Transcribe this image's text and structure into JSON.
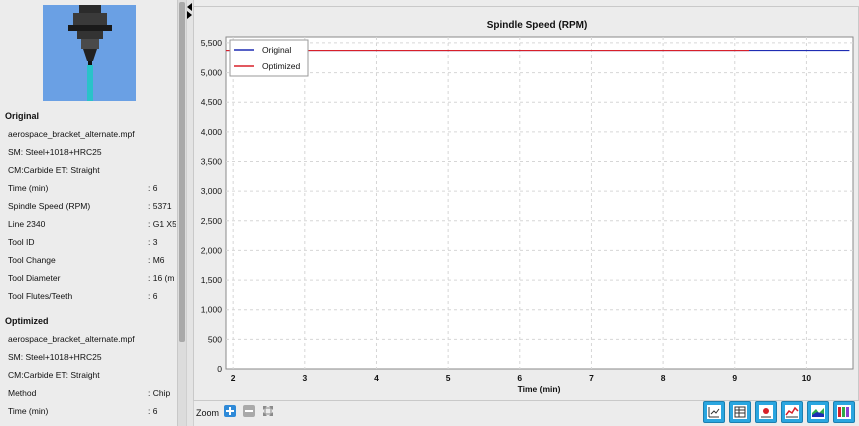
{
  "tool_image": {
    "icon": "cutting-tool-image"
  },
  "original": {
    "heading": "Original",
    "file": "aerospace_bracket_alternate.mpf",
    "sm": "SM: Steel+1018+HRC25",
    "cm": "CM:Carbide ET: Straight",
    "rows": [
      {
        "label": "Time (min)",
        "value": ": 6"
      },
      {
        "label": "Spindle Speed (RPM)",
        "value": ": 5371"
      },
      {
        "label": "Line 2340",
        "value": ": G1 X5"
      },
      {
        "label": "Tool ID",
        "value": ": 3"
      },
      {
        "label": "Tool Change",
        "value": ": M6"
      },
      {
        "label": "Tool Diameter",
        "value": ": 16 (m"
      },
      {
        "label": "Tool Flutes/Teeth",
        "value": ": 6"
      }
    ]
  },
  "optimized": {
    "heading": "Optimized",
    "file": "aerospace_bracket_alternate.mpf",
    "sm": "SM: Steel+1018+HRC25",
    "cm": "CM:Carbide ET: Straight",
    "rows": [
      {
        "label": "Method",
        "value": ": Chip"
      },
      {
        "label": "Time (min)",
        "value": ": 6"
      }
    ]
  },
  "toolbar": {
    "zoom_label": "Zoom",
    "buttons": [
      "chart-properties-icon",
      "data-table-icon",
      "marker-icon",
      "line-chart-icon",
      "area-chart-icon",
      "color-bars-icon"
    ]
  },
  "colors": {
    "original": "#1f2db3",
    "optimized": "#d8202a",
    "accent": "#2aa6e0"
  },
  "chart_data": {
    "type": "line",
    "title": "Spindle Speed (RPM)",
    "xlabel": "Time (min)",
    "ylabel": "",
    "xlim": [
      1.9,
      10.65
    ],
    "ylim": [
      0,
      5600
    ],
    "xticks": [
      2,
      3,
      4,
      5,
      6,
      7,
      8,
      9,
      10
    ],
    "yticks": [
      0,
      500,
      1000,
      1500,
      2000,
      2500,
      3000,
      3500,
      4000,
      4500,
      5000,
      5500
    ],
    "grid": true,
    "legend_position": "top-left",
    "series": [
      {
        "name": "Original",
        "color": "#1f2db3",
        "x": [
          1.9,
          10.6
        ],
        "y": [
          5371,
          5371
        ]
      },
      {
        "name": "Optimized",
        "color": "#d8202a",
        "x": [
          1.9,
          9.2
        ],
        "y": [
          5371,
          5371
        ]
      }
    ]
  }
}
